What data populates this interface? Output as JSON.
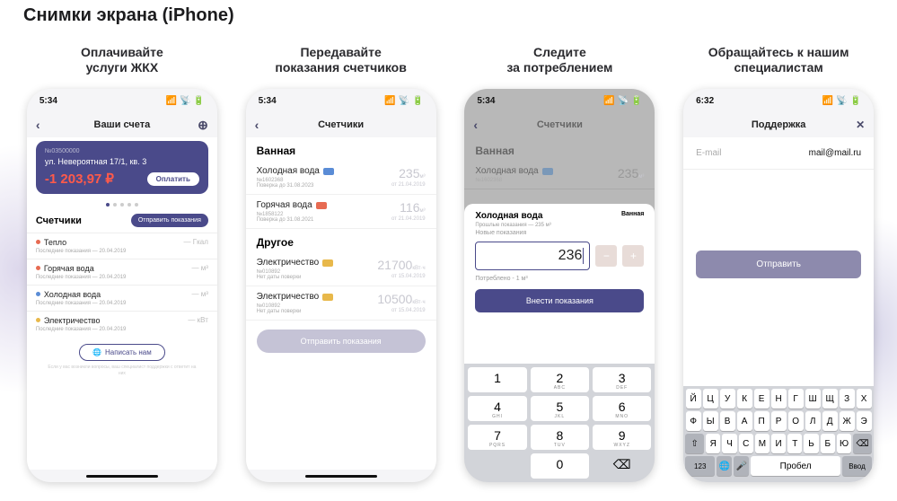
{
  "page_title": "Снимки экрана (iPhone)",
  "captions": [
    "Оплачивайте\nуслуги ЖКХ",
    "Передавайте\nпоказания счетчиков",
    "Следите\nза потреблением",
    "Обращайтесь к нашим\nспециалистам"
  ],
  "status_time_a": "5:34",
  "status_time_b": "6:32",
  "screen1": {
    "nav_title": "Ваши счета",
    "account_no": "№03500000",
    "address": "ул. Невероятная 17/1, кв. 3",
    "amount": "-1 203,97 ₽",
    "pay_label": "Оплатить",
    "meters_title": "Счетчики",
    "send_label": "Отправить показания",
    "items": [
      {
        "name": "Тепло",
        "sub": "Последние показания — 20.04.2019",
        "unit": "— Гкал",
        "color": "#e76b52"
      },
      {
        "name": "Горячая вода",
        "sub": "Последние показания — 20.04.2019",
        "unit": "— м³",
        "color": "#e76b52"
      },
      {
        "name": "Холодная вода",
        "sub": "Последние показания — 20.04.2019",
        "unit": "— м³",
        "color": "#5a8cd6"
      },
      {
        "name": "Электричество",
        "sub": "Последние показания — 20.04.2019",
        "unit": "— кВт",
        "color": "#e8b84a"
      }
    ],
    "write_label": "Написать нам",
    "fine_print": "Если у вас возникли вопросы, ваш специалист поддержки с ответит на них"
  },
  "screen2": {
    "nav_title": "Счетчики",
    "sec1": "Ванная",
    "sec2": "Другое",
    "rows": [
      {
        "name": "Холодная вода",
        "id": "№1602368",
        "check": "Поверка до 31.08.2023",
        "val": "235",
        "unit": "м³",
        "date": "от 21.04.2019",
        "color": "#5a8cd6"
      },
      {
        "name": "Горячая вода",
        "id": "№1858122",
        "check": "Поверка до 31.08.2021",
        "val": "116",
        "unit": "м³",
        "date": "от 21.04.2019",
        "color": "#e76b52"
      },
      {
        "name": "Электричество",
        "id": "№010892",
        "check": "Нет даты поверки",
        "val": "21700",
        "unit": "кВт·ч",
        "date": "от 15.04.2019",
        "color": "#e8b84a"
      },
      {
        "name": "Электричество",
        "id": "№010892",
        "check": "Нет даты поверки",
        "val": "10500",
        "unit": "кВт·ч",
        "date": "от 15.04.2019",
        "color": "#e8b84a"
      }
    ],
    "send_label": "Отправить показания"
  },
  "screen3": {
    "nav_title": "Счетчики",
    "dim_sec": "Ванная",
    "dim_name": "Холодная вода",
    "dim_id": "№1602368",
    "dim_val": "235",
    "dim_unit": "м³",
    "title": "Холодная вода",
    "prev": "Прошлые показания — 235 м³",
    "room": "Ванная",
    "new_label": "Новые показания",
    "input_value": "236",
    "consumed": "Потреблено - 1 м³",
    "submit": "Внести показания",
    "keys": [
      {
        "n": "1",
        "l": ""
      },
      {
        "n": "2",
        "l": "ABC"
      },
      {
        "n": "3",
        "l": "DEF"
      },
      {
        "n": "4",
        "l": "GHI"
      },
      {
        "n": "5",
        "l": "JKL"
      },
      {
        "n": "6",
        "l": "MNO"
      },
      {
        "n": "7",
        "l": "PQRS"
      },
      {
        "n": "8",
        "l": "TUV"
      },
      {
        "n": "9",
        "l": "WXYZ"
      }
    ],
    "key0": "0",
    "del": "⌫"
  },
  "screen4": {
    "nav_title": "Поддержка",
    "field_label": "E-mail",
    "field_value": "mail@mail.ru",
    "submit": "Отправить",
    "kbd_r1": [
      "Й",
      "Ц",
      "У",
      "К",
      "Е",
      "Н",
      "Г",
      "Ш",
      "Щ",
      "З",
      "Х"
    ],
    "kbd_r2": [
      "Ф",
      "Ы",
      "В",
      "А",
      "П",
      "Р",
      "О",
      "Л",
      "Д",
      "Ж",
      "Э"
    ],
    "kbd_r3": [
      "Я",
      "Ч",
      "С",
      "М",
      "И",
      "Т",
      "Ь",
      "Б",
      "Ю"
    ],
    "shift": "⇧",
    "del": "⌫",
    "num": "123",
    "globe": "🌐",
    "mic": "🎤",
    "space": "Пробел",
    "enter": "Ввод"
  }
}
